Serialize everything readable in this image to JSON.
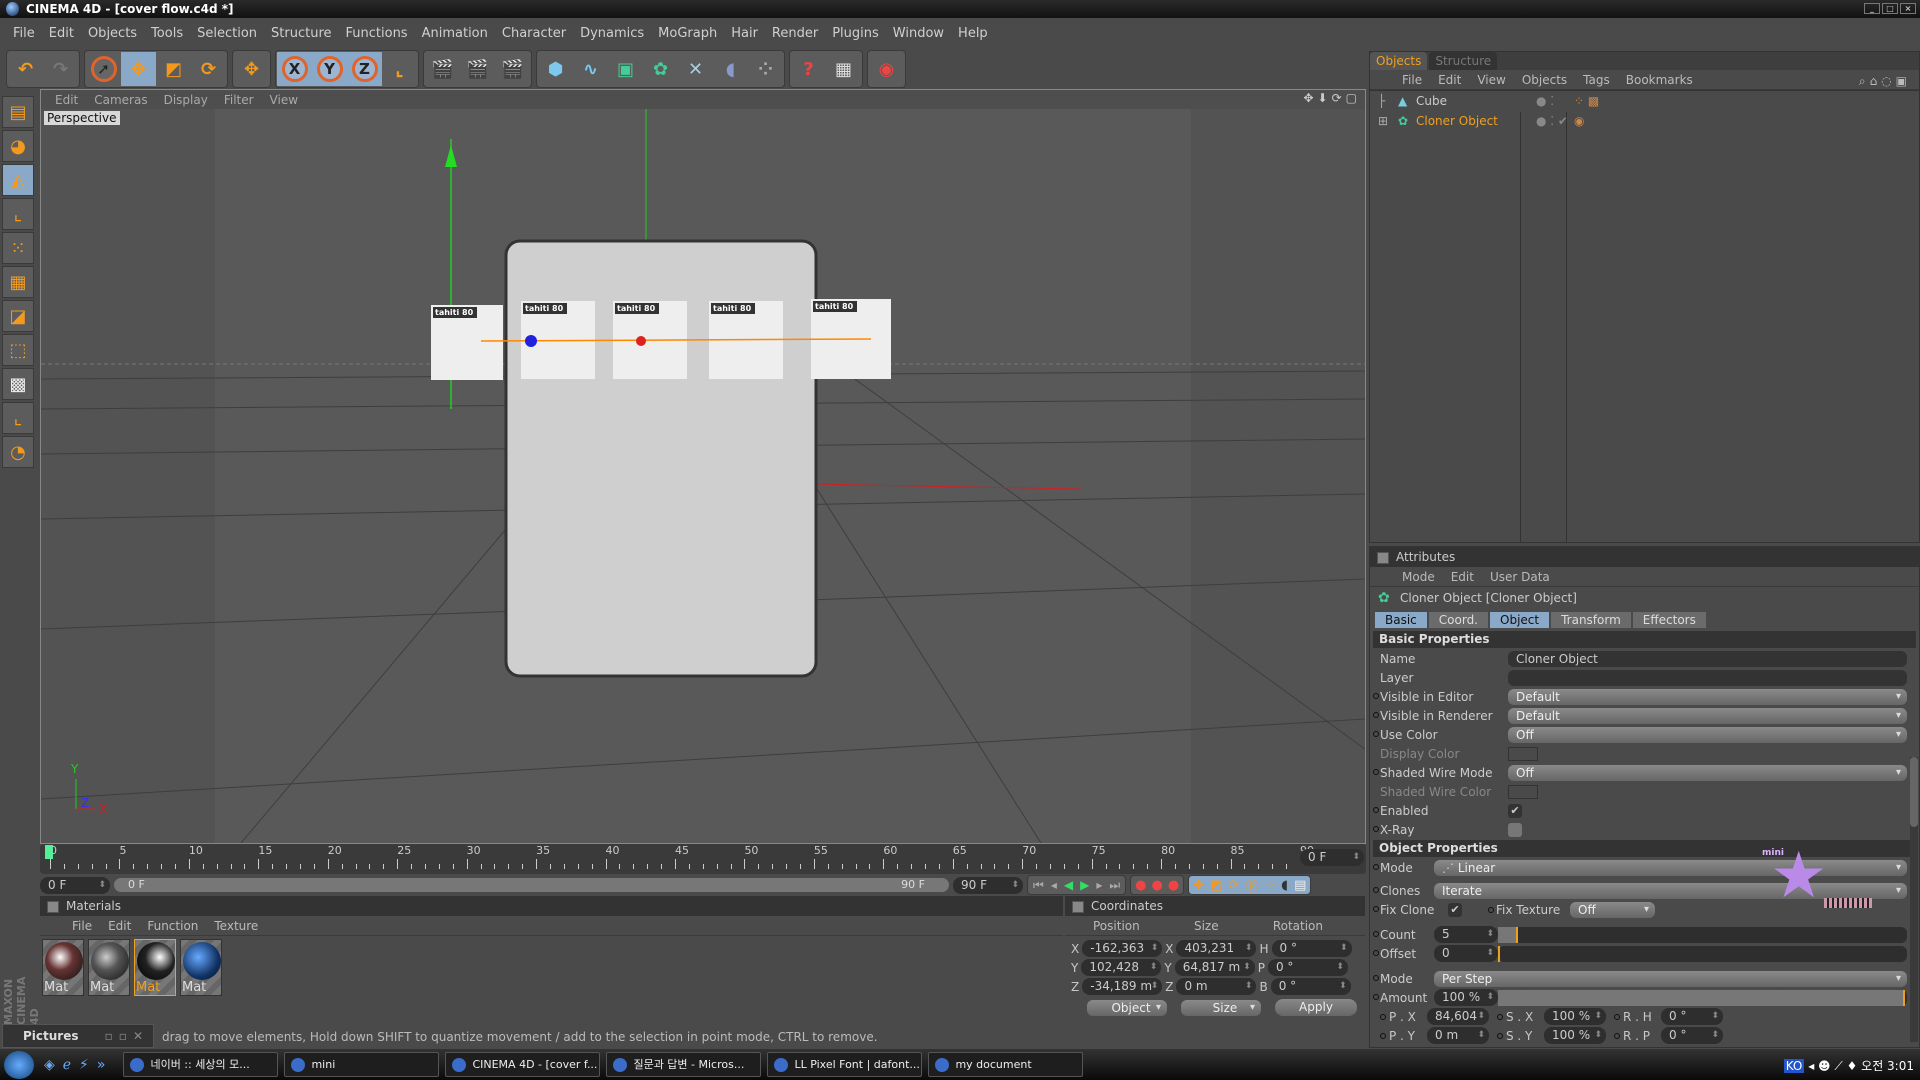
{
  "window": {
    "title": "CINEMA 4D - [cover flow.c4d *]",
    "controls": [
      "_",
      "□",
      "×"
    ]
  },
  "menubar": [
    "File",
    "Edit",
    "Objects",
    "Tools",
    "Selection",
    "Structure",
    "Functions",
    "Animation",
    "Character",
    "Dynamics",
    "MoGraph",
    "Hair",
    "Render",
    "Plugins",
    "Window",
    "Help"
  ],
  "toolbar": {
    "axis": [
      "X",
      "Y",
      "Z"
    ]
  },
  "viewport": {
    "menu": [
      "Edit",
      "Cameras",
      "Display",
      "Filter",
      "View"
    ],
    "camera": "Perspective",
    "axis_labels": {
      "y": "Y",
      "z": "Z",
      "x": "X"
    },
    "card_label": "tahiti 80"
  },
  "timeline": {
    "ticks": [
      "0",
      "5",
      "10",
      "15",
      "20",
      "25",
      "30",
      "35",
      "40",
      "45",
      "50",
      "55",
      "60",
      "65",
      "70",
      "75",
      "80",
      "85",
      "90"
    ],
    "current_frame": "0 F",
    "start": "0 F",
    "range_start": "0 F",
    "range_end": "90 F",
    "end": "90 F",
    "progress": 0
  },
  "materials": {
    "title": "Materials",
    "menu": [
      "File",
      "Edit",
      "Function",
      "Texture"
    ],
    "items": [
      {
        "label": "Mat",
        "selected": false
      },
      {
        "label": "Mat",
        "selected": false
      },
      {
        "label": "Mat",
        "selected": true
      },
      {
        "label": "Mat",
        "selected": false
      }
    ]
  },
  "coordinates": {
    "title": "Coordinates",
    "headers": [
      "Position",
      "Size",
      "Rotation"
    ],
    "rows": [
      {
        "a": "X",
        "pos": "-162,363 m",
        "b": "X",
        "size": "403,231 m",
        "c": "H",
        "rot": "0 °"
      },
      {
        "a": "Y",
        "pos": "102,428 m",
        "b": "Y",
        "size": "64,817 m",
        "c": "P",
        "rot": "0 °"
      },
      {
        "a": "Z",
        "pos": "-34,189 m",
        "b": "Z",
        "size": "0 m",
        "c": "B",
        "rot": "0 °"
      }
    ],
    "mode": "Object",
    "size_mode": "Size",
    "apply": "Apply"
  },
  "status": "drag to move elements, Hold down SHIFT to quantize movement / add to the selection in point mode, CTRL to remove.",
  "pictures_window": "Pictures",
  "branding": "MAXON CINEMA 4D",
  "objects": {
    "tabs": [
      "Objects",
      "Structure"
    ],
    "menu": [
      "File",
      "Edit",
      "View",
      "Objects",
      "Tags",
      "Bookmarks"
    ],
    "items": [
      {
        "name": "Cube",
        "active": false
      },
      {
        "name": "Cloner Object",
        "active": true
      }
    ]
  },
  "attributes": {
    "title": "Attributes",
    "menu": [
      "Mode",
      "Edit",
      "User Data"
    ],
    "object_title": "Cloner Object [Cloner Object]",
    "tabs": [
      {
        "label": "Basic",
        "on": true
      },
      {
        "label": "Coord.",
        "on": false
      },
      {
        "label": "Object",
        "on": true
      },
      {
        "label": "Transform",
        "on": false
      },
      {
        "label": "Effectors",
        "on": false
      }
    ],
    "basic_title": "Basic Properties",
    "basic": {
      "name_label": "Name",
      "name": "Cloner Object",
      "layer_label": "Layer",
      "vis_editor_label": "Visible in Editor",
      "vis_editor": "Default",
      "vis_render_label": "Visible in Renderer",
      "vis_render": "Default",
      "use_color_label": "Use Color",
      "use_color": "Off",
      "display_color_label": "Display Color",
      "shaded_wire_mode_label": "Shaded Wire Mode",
      "shaded_wire_mode": "Off",
      "shaded_wire_color_label": "Shaded Wire Color",
      "enabled_label": "Enabled",
      "enabled": true,
      "xray_label": "X-Ray",
      "xray": false
    },
    "object_title2": "Object Properties",
    "object": {
      "mode_label": "Mode",
      "mode": "Linear",
      "clones_label": "Clones",
      "clones": "Iterate",
      "fix_clone_label": "Fix Clone",
      "fix_clone": true,
      "fix_texture_label": "Fix Texture",
      "fix_texture": "Off",
      "count_label": "Count",
      "count": "5",
      "count_slider": 0.05,
      "offset_label": "Offset",
      "offset": "0",
      "offset_slider": 0,
      "step_mode_label": "Mode",
      "step_mode": "Per Step",
      "amount_label": "Amount",
      "amount": "100 %",
      "amount_slider": 1.0,
      "px_label": "P . X",
      "px": "84,604 m",
      "sx_label": "S . X",
      "sx": "100 %",
      "rh_label": "R . H",
      "rh": "0 °",
      "py_label": "P . Y",
      "py": "0 m",
      "sy_label": "S . Y",
      "sy": "100 %",
      "rp_label": "R . P",
      "rp": "0 °"
    }
  },
  "mini_widget": {
    "label": "mini"
  },
  "taskbar": {
    "items": [
      "네이버 :: 세상의 모...",
      "mini",
      "CINEMA 4D - [cover f...",
      "질문과 답변 - Micros...",
      "LL Pixel Font | dafont...",
      "my document"
    ],
    "tray_ime": "KO",
    "clock": "오전 3:01"
  },
  "colors": {
    "accent": "#f0a020",
    "tab_active": "#8aa8c8",
    "background": "#4a4a4a"
  }
}
